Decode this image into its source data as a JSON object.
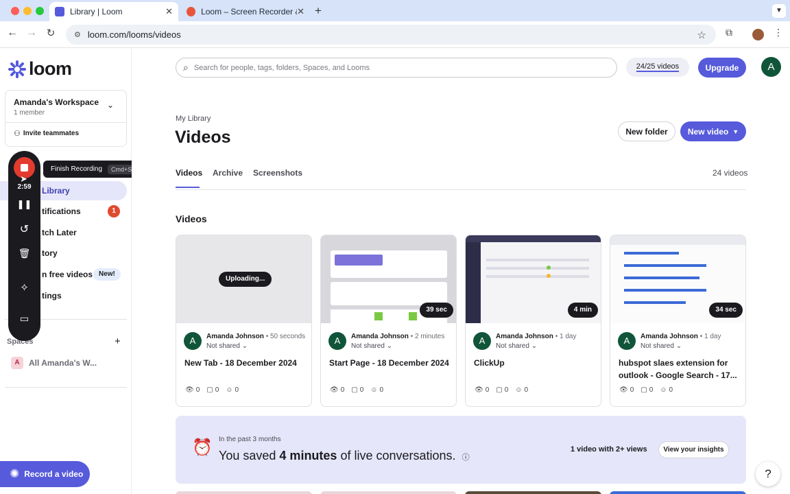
{
  "browser": {
    "tabs": [
      {
        "title": "Library | Loom",
        "active": true
      },
      {
        "title": "Loom – Screen Recorder & Sc",
        "active": false
      }
    ],
    "url": "loom.com/looms/videos",
    "new_tab_label": "+"
  },
  "sidebar": {
    "logo": "loom",
    "workspace": {
      "name": "Amanda's Workspace",
      "members": "1 member",
      "invite": "Invite teammates"
    },
    "nav": [
      {
        "label": "Library",
        "active": true
      },
      {
        "label": "tifications",
        "badge": "1"
      },
      {
        "label": "tch Later"
      },
      {
        "label": "tory"
      },
      {
        "label": "n free videos",
        "badge_new": "New!"
      },
      {
        "label": "tings"
      }
    ],
    "spaces_label": "Spaces",
    "spaces_add": "+",
    "space_item": {
      "initial": "A",
      "label": "All Amanda's W..."
    },
    "record_button": "Record a video"
  },
  "recorder": {
    "timer": "2:59",
    "tooltip": "Finish Recording",
    "tooltip_shortcut": "Cmd+Shift+L"
  },
  "header": {
    "search_placeholder": "Search for people, tags, folders, Spaces, and Looms",
    "quota": "24/25 videos",
    "upgrade": "Upgrade",
    "avatar_initial": "A"
  },
  "library": {
    "breadcrumb": "My Library",
    "title": "Videos",
    "new_folder": "New folder",
    "new_video": "New video",
    "tabs": [
      "Videos",
      "Archive",
      "Screenshots"
    ],
    "count": "24 videos",
    "section_title": "Videos"
  },
  "videos": [
    {
      "status": "Uploading...",
      "duration": "",
      "author": "Amanda Johnson",
      "time": "50 seconds",
      "share": "Not shared",
      "title": "New Tab - 18 December 2024",
      "views": "0",
      "comments": "0",
      "reactions": "0"
    },
    {
      "status": "",
      "duration": "39 sec",
      "author": "Amanda Johnson",
      "time": "2 minutes",
      "share": "Not shared",
      "title": "Start Page - 18 December 2024",
      "views": "0",
      "comments": "0",
      "reactions": "0"
    },
    {
      "status": "",
      "duration": "4 min",
      "author": "Amanda Johnson",
      "time": "1 day",
      "share": "Not shared",
      "title": "ClickUp",
      "views": "0",
      "comments": "0",
      "reactions": "0"
    },
    {
      "status": "",
      "duration": "34 sec",
      "author": "Amanda Johnson",
      "time": "1 day",
      "share": "Not shared",
      "title": "hubspot slaes extension for outlook - Google Search - 17...",
      "views": "0",
      "comments": "0",
      "reactions": "0"
    }
  ],
  "insights": {
    "period": "In the past 3 months",
    "pre": "You saved ",
    "amount": "4 minutes",
    "post": " of live conversations.",
    "stat": "1 video with 2+ views",
    "button": "View your insights"
  },
  "help": "?"
}
